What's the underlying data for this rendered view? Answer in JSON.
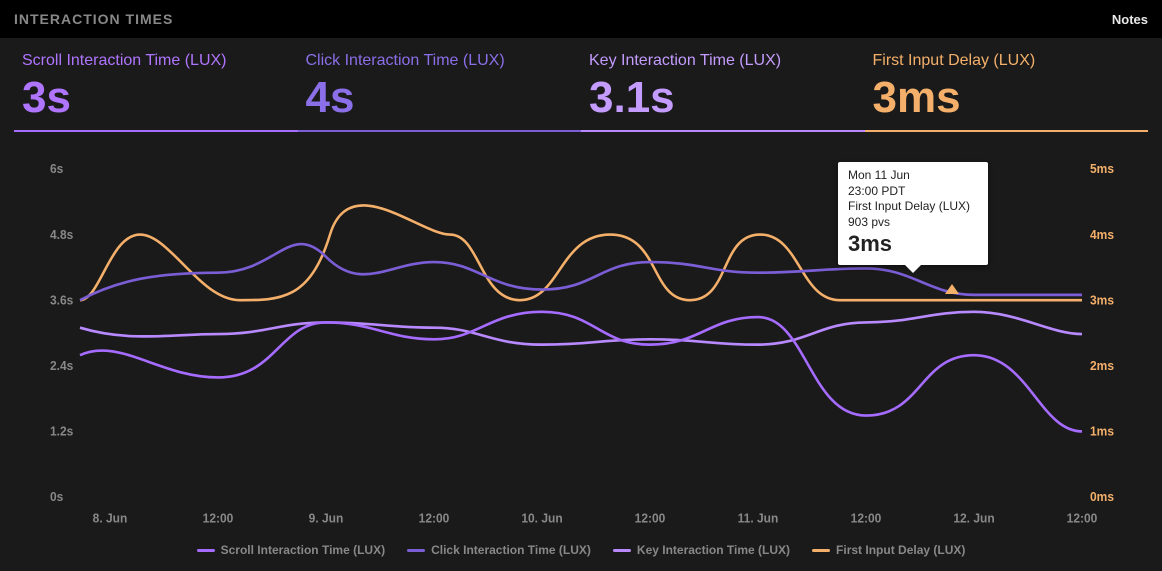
{
  "header": {
    "title": "INTERACTION TIMES",
    "notes_label": "Notes"
  },
  "metrics": {
    "scroll": {
      "label": "Scroll Interaction Time (LUX)",
      "value": "3s"
    },
    "click": {
      "label": "Click Interaction Time (LUX)",
      "value": "4s"
    },
    "key": {
      "label": "Key Interaction Time (LUX)",
      "value": "3.1s"
    },
    "fid": {
      "label": "First Input Delay (LUX)",
      "value": "3ms"
    }
  },
  "axes": {
    "left": {
      "ticks": [
        "0s",
        "1.2s",
        "2.4s",
        "3.6s",
        "4.8s",
        "6s"
      ]
    },
    "right": {
      "ticks": [
        "0ms",
        "1ms",
        "2ms",
        "3ms",
        "4ms",
        "5ms"
      ]
    },
    "x": {
      "ticks": [
        "8. Jun",
        "12:00",
        "9. Jun",
        "12:00",
        "10. Jun",
        "12:00",
        "11. Jun",
        "12:00",
        "12. Jun",
        "12:00"
      ]
    }
  },
  "legend": {
    "scroll": "Scroll Interaction Time (LUX)",
    "click": "Click Interaction Time (LUX)",
    "key": "Key Interaction Time (LUX)",
    "fid": "First Input Delay (LUX)"
  },
  "tooltip": {
    "date": "Mon 11 Jun",
    "time": "23:00 PDT",
    "series": "First Input Delay (LUX)",
    "pvs": "903 pvs",
    "value": "3ms"
  },
  "colors": {
    "scroll": "#a66bff",
    "click": "#7b5ed6",
    "key": "#b889ff",
    "fid": "#f4b06a"
  },
  "chart_data": {
    "type": "line",
    "xlabel": "",
    "ylabel_left": "seconds",
    "ylabel_right": "ms",
    "ylim_left": [
      0,
      6
    ],
    "ylim_right": [
      0,
      5
    ],
    "x": [
      "8. Jun 00:00",
      "8. Jun 12:00",
      "9. Jun 00:00",
      "9. Jun 12:00",
      "10. Jun 00:00",
      "10. Jun 12:00",
      "11. Jun 00:00",
      "11. Jun 12:00",
      "12. Jun 00:00",
      "12. Jun 12:00"
    ],
    "series": [
      {
        "name": "Scroll Interaction Time (LUX)",
        "axis": "left",
        "values": [
          2.6,
          2.2,
          3.2,
          2.9,
          3.4,
          2.8,
          3.3,
          1.5,
          2.6,
          1.2
        ]
      },
      {
        "name": "Click Interaction Time (LUX)",
        "axis": "left",
        "values": [
          3.6,
          4.1,
          4.4,
          4.3,
          3.8,
          4.3,
          4.1,
          4.2,
          3.7,
          3.7
        ]
      },
      {
        "name": "Key Interaction Time (LUX)",
        "axis": "left",
        "values": [
          3.1,
          3.0,
          3.2,
          3.1,
          2.8,
          2.9,
          2.8,
          3.2,
          3.4,
          3.0
        ]
      },
      {
        "name": "First Input Delay (LUX)",
        "axis": "right",
        "values": [
          3,
          3,
          4,
          4,
          3,
          4,
          4,
          3,
          3,
          3
        ]
      }
    ],
    "annotations": [
      {
        "x": "11. Jun 23:00",
        "series": "First Input Delay (LUX)",
        "text": "3ms",
        "pvs": 903
      }
    ]
  }
}
